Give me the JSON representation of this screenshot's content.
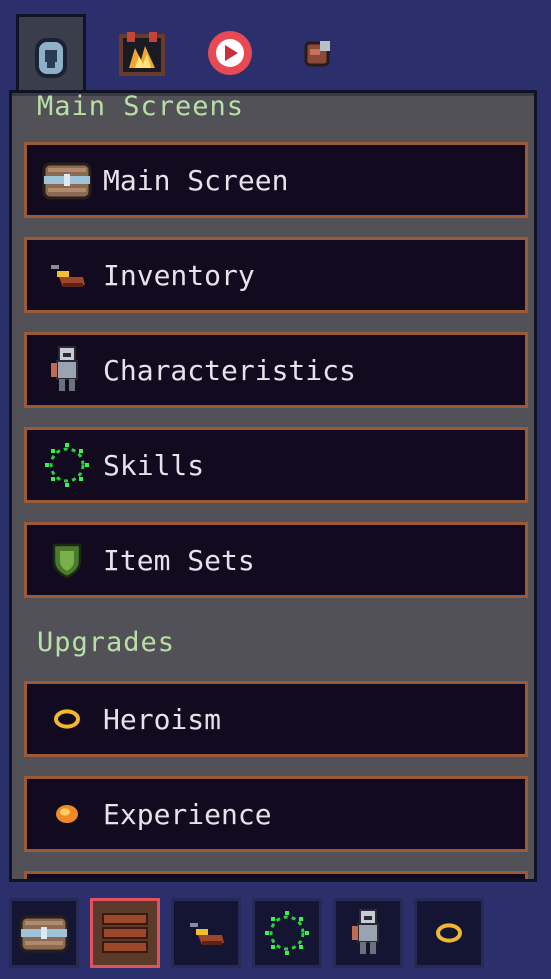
{
  "tabs": [
    {
      "icon": "tombstone-icon",
      "active": true
    },
    {
      "icon": "forge-icon",
      "active": false
    },
    {
      "icon": "play-video-icon",
      "active": false
    },
    {
      "icon": "gauntlet-icon",
      "active": false
    }
  ],
  "panel": {
    "section_main": "Main Screens",
    "main_items": [
      {
        "label": "Main Screen",
        "icon": "chest-icon"
      },
      {
        "label": "Inventory",
        "icon": "boot-icon"
      },
      {
        "label": "Characteristics",
        "icon": "knight-icon"
      },
      {
        "label": "Skills",
        "icon": "skills-ring-icon"
      },
      {
        "label": "Item Sets",
        "icon": "shield-icon"
      }
    ],
    "section_upgrades": "Upgrades",
    "upgrade_items": [
      {
        "label": "Heroism",
        "icon": "gold-ring-icon"
      },
      {
        "label": "Experience",
        "icon": "orange-orb-icon"
      }
    ]
  },
  "bottom_bar": [
    {
      "icon": "chest-icon",
      "active": false
    },
    {
      "icon": "menu-icon",
      "active": true
    },
    {
      "icon": "boot-icon",
      "active": false
    },
    {
      "icon": "skills-ring-icon",
      "active": false
    },
    {
      "icon": "knight-icon",
      "active": false
    },
    {
      "icon": "gold-ring-icon",
      "active": false
    }
  ],
  "colors": {
    "background": "#2b2f6b",
    "panel": "#525157",
    "button_bg": "#120b1f",
    "button_border": "#9a5a38",
    "section_text": "#b8e0a6",
    "active_slot_border": "#e05262"
  }
}
